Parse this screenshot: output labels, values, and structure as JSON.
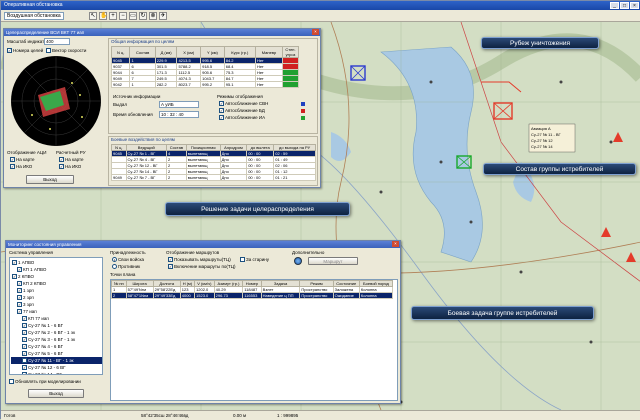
{
  "app": {
    "title": "Оперативная обстановка"
  },
  "menubar": {
    "dropdown": "Воздушная обстановка"
  },
  "toolbar": {
    "icons": [
      "pointer-icon",
      "hand-icon",
      "zoom-in-icon",
      "zoom-out-icon",
      "zoom-rect-icon",
      "refresh-icon",
      "binoculars-icon",
      "plane-icon"
    ]
  },
  "callouts": {
    "kill_line": "Рубеж уничтожения",
    "fighter_group": "Состав группы истребителей",
    "target_assign": "Решение задачи целераспределения",
    "combat_order": "Боевая задача группе истребителей"
  },
  "target_window": {
    "title": "Целераспределение ВСИ ВКТ 77 иап",
    "scale_label": "Масштаб индикатора",
    "scale_value": "400",
    "check_target_numbers": "Номера целей",
    "check_speed_vector": "Вектор скорости",
    "display_label": "Отображение АЦИ",
    "display_onmap": "На карте",
    "display_onikо": "На ИКО",
    "calc_label": "Расчетный РУ",
    "calc_onmap": "На карте",
    "calc_onikо": "На ИКО",
    "exit_btn": "Выход",
    "gen_title": "Общая информация по целям",
    "gen_headers": [
      "N ц.",
      "Состав",
      "Д (км)",
      "X (км)",
      "Y (км)",
      "Курс (гр.)",
      "Маневр",
      "Степ. угроз"
    ],
    "gen_rows": [
      [
        "9045",
        "1",
        "229.9",
        "4213.5",
        "995.6",
        "84.2",
        "Нет",
        ""
      ],
      [
        "9037",
        "6",
        "301.5",
        "5788.2",
        "918.5",
        "68.4",
        "Нет",
        ""
      ],
      [
        "9044",
        "6",
        "171.3",
        "1112.5",
        "905.6",
        "75.3",
        "Нет",
        ""
      ],
      [
        "9049",
        "7",
        "249.5",
        "4074.3",
        "1043.7",
        "84.7",
        "Нет",
        ""
      ],
      [
        "9042",
        "1",
        "282.2",
        "8023.7",
        "995.2",
        "95.1",
        "Нет",
        ""
      ]
    ],
    "source_label": "Источник информации",
    "source_display": "Выдал",
    "source_value": "А уИБ",
    "time_label": "Время обновления",
    "time_value": "10 : 32 : 40",
    "modes_label": "Режимы отображения",
    "mode1": "Автосближение СВН",
    "mode2": "Автосближение БД",
    "mode3": "Автосближение ИА",
    "combat_title": "Боевые воздействия по целям",
    "combat_headers": [
      "N ц.",
      "Ведущий",
      "Состав",
      "Позиционная",
      "Аэродром",
      "до вылета",
      "до выхода на РУ"
    ],
    "combat_rows": [
      [
        "9045",
        "Су-27 № 1 - ВГ",
        "4",
        "вылетающ",
        "Дно",
        "00 : 00",
        "02 : 59"
      ],
      [
        "",
        "Су-27 № 4 - ВГ",
        "2",
        "вылетающ",
        "Дно",
        "00 : 00",
        "01 : 49"
      ],
      [
        "",
        "Су-27 № 12 - ВГ",
        "2",
        "вылетающ",
        "Дно",
        "00 : 00",
        "02 : 06"
      ],
      [
        "",
        "Су-27 № 14 - ВГ",
        "2",
        "вылетающ",
        "Дно",
        "00 : 00",
        "01 : 12"
      ],
      [
        "9049",
        "Су-27 № 7 - ВГ",
        "2",
        "вылетающ",
        "Дно",
        "00 : 00",
        "01 : 21"
      ]
    ]
  },
  "control_window": {
    "title": "Мониторинг состояния управления",
    "tree_label": "Система управления",
    "tree": [
      "1 АПВО",
      "КП 1 АПВО",
      "2 КПВО",
      "КП 2 КПВО",
      "1 зрп",
      "2 зрп",
      "3 зрп",
      "77 иап",
      "КП 77 иап",
      "Су-27 № 1 - 6 ВГ",
      "Су-27 № 2 - 6 ВГ - 1 эк",
      "Су-27 № 3 - 6 ВГ - 1 эк",
      "Су-27 № 4 - 6 ВГ",
      "Су-27 № 5 - 6 ВГ",
      "Су-27 № 11 - ВГ - 1 эк",
      "Су-27 № 12 - 6 ВГ",
      "Су-27 № 14 - ВГ"
    ],
    "refresh_check": "Обновлять при моделировании",
    "exit_btn": "Выход",
    "own_label": "Принадлежность",
    "own1": "Свои войска",
    "own2": "Противник",
    "routes_label": "Отображение маршрутов",
    "route1": "Показывать маршруты(ТЦ)",
    "route2": "Включение маршруты по(ТЦ)",
    "extra_label": "Дополнительно",
    "extra_btn": "Маршрут",
    "backward": "За старину",
    "points_label": "Точки плана",
    "plan_headers": [
      "№ пп",
      "Широта",
      "Долгота",
      "Н (м)",
      "V (км/ч)",
      "Азимут (гр.)",
      "Номер",
      "Задача",
      "Режим",
      "Состояние",
      "Боевой поряд"
    ],
    "plan_rows": [
      [
        "1",
        "57°49'Nгм",
        "29°58'22Eд",
        "123",
        "1202.0",
        "40.29",
        "118487",
        "Взлет",
        "Пространство",
        "Заложена",
        "Колонна"
      ],
      [
        "2",
        "58°47'1Nгм",
        "29°49'33Eд",
        "4000",
        "1523.0",
        "296.73",
        "116553",
        "Наведение ц ПП",
        "Пространство",
        "Ожидание",
        "Колонна"
      ]
    ]
  },
  "status": {
    "left": "Готов",
    "coords": "58°42'35сш  28°46'46вд",
    "height": "0.00 м",
    "scale": "1 : 999895"
  }
}
